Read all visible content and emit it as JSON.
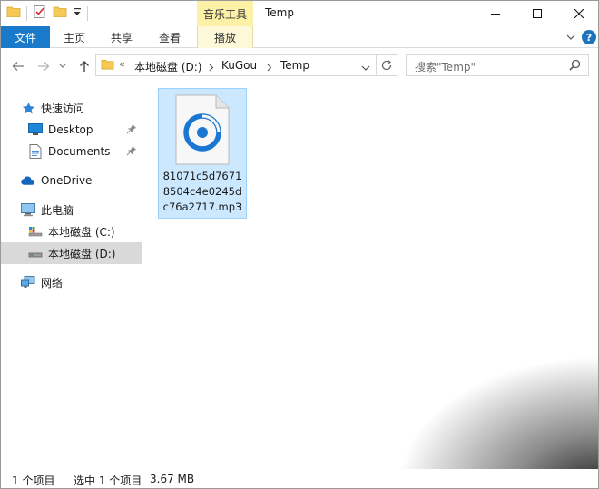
{
  "titlebar": {
    "context_group": "音乐工具",
    "title": "Temp",
    "minimize": "—",
    "maximize": "☐",
    "close": "✕"
  },
  "ribbon": {
    "tabs": [
      {
        "label": "文件"
      },
      {
        "label": "主页"
      },
      {
        "label": "共享"
      },
      {
        "label": "查看"
      },
      {
        "label": "播放"
      }
    ]
  },
  "address": {
    "overflow": "«",
    "crumbs": [
      "本地磁盘 (D:)",
      "KuGou",
      "Temp"
    ],
    "search_placeholder": "搜索\"Temp\""
  },
  "sidebar": {
    "items": [
      {
        "label": "快速访问",
        "icon": "star-icon"
      },
      {
        "label": "Desktop",
        "icon": "desktop-icon"
      },
      {
        "label": "Documents",
        "icon": "documents-icon"
      },
      {
        "label": "OneDrive",
        "icon": "cloud-icon"
      },
      {
        "label": "此电脑",
        "icon": "computer-icon"
      },
      {
        "label": "本地磁盘 (C:)",
        "icon": "drive-icon"
      },
      {
        "label": "本地磁盘 (D:)",
        "icon": "drive-icon"
      },
      {
        "label": "网络",
        "icon": "network-icon"
      }
    ]
  },
  "files": [
    {
      "name": "81071c5d76718504c4e0245dc76a2717.mp3",
      "icon": "music-file-icon"
    }
  ],
  "status": {
    "count": "1 个项目",
    "selection": "选中 1 个项目",
    "size": "3.67 MB"
  },
  "colors": {
    "accent": "#1979ca",
    "context_tab": "#fcf1a6",
    "selection": "#cce8ff"
  }
}
